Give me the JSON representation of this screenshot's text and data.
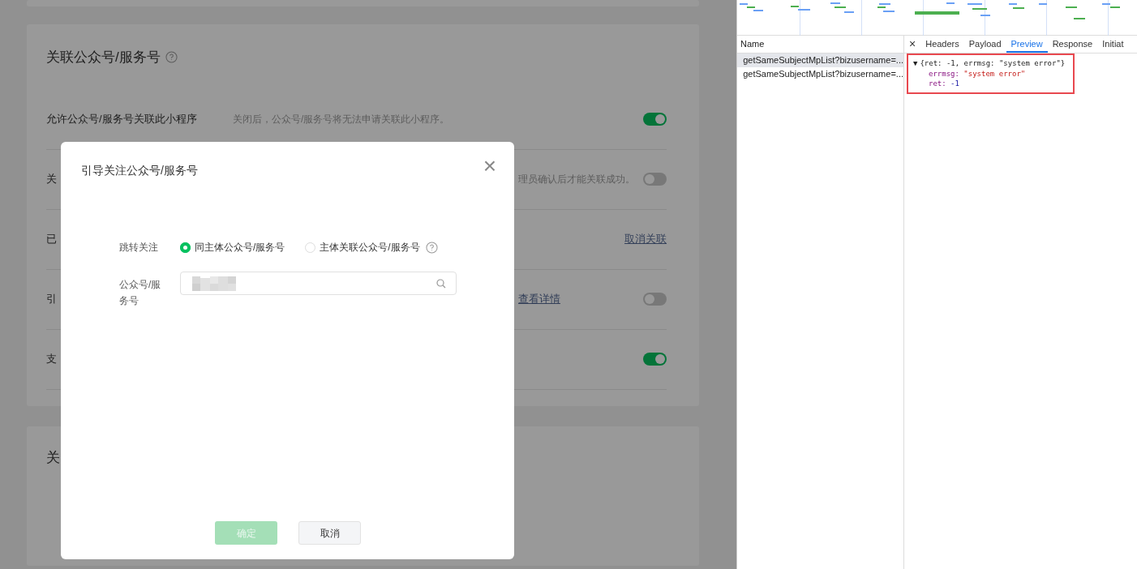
{
  "page": {
    "section": {
      "title": "关联公众号/服务号",
      "rows": [
        {
          "label": "允许公众号/服务号关联此小程序",
          "description": "关闭后，公众号/服务号将无法申请关联此小程序。",
          "kind": "toggle",
          "on": true
        },
        {
          "label": "关",
          "description": "理员确认后才能关联成功。",
          "kind": "toggle",
          "on": false
        },
        {
          "label": "已",
          "kind": "link",
          "action": "取消关联"
        },
        {
          "label": "引",
          "description": "查看详情",
          "kind": "toggle",
          "on": false
        },
        {
          "label": "支",
          "kind": "toggle",
          "on": true
        }
      ]
    },
    "next_section": {
      "title": "关"
    }
  },
  "dialog": {
    "title": "引导关注公众号/服务号",
    "close": "×",
    "follow_label": "跳转关注",
    "options": [
      {
        "label": "同主体公众号/服务号",
        "selected": true,
        "help": false
      },
      {
        "label": "主体关联公众号/服务号",
        "selected": false,
        "help": true
      }
    ],
    "account_label": "公众号/服务号",
    "buttons": [
      {
        "label": "确定",
        "kind": "primary",
        "disabled": true
      },
      {
        "label": "取消",
        "kind": "default",
        "disabled": false
      }
    ]
  },
  "devtools": {
    "name_header": "Name",
    "requests": [
      {
        "name": "getSameSubjectMpList?bizusername=...",
        "selected": true
      },
      {
        "name": "getSameSubjectMpList?bizusername=...",
        "selected": false
      }
    ],
    "close": "×",
    "tabs": [
      {
        "label": "Headers",
        "selected": false
      },
      {
        "label": "Payload",
        "selected": false
      },
      {
        "label": "Preview",
        "selected": true
      },
      {
        "label": "Response",
        "selected": false
      },
      {
        "label": "Initiat",
        "selected": false
      }
    ],
    "preview": {
      "toggle": "▼",
      "summary": "{ret: -1, errmsg: \"system error\"}",
      "fields": [
        {
          "key": "errmsg:",
          "value": "\"system error\"",
          "kind": "string"
        },
        {
          "key": "ret:",
          "value": "-1",
          "kind": "number"
        }
      ]
    }
  }
}
